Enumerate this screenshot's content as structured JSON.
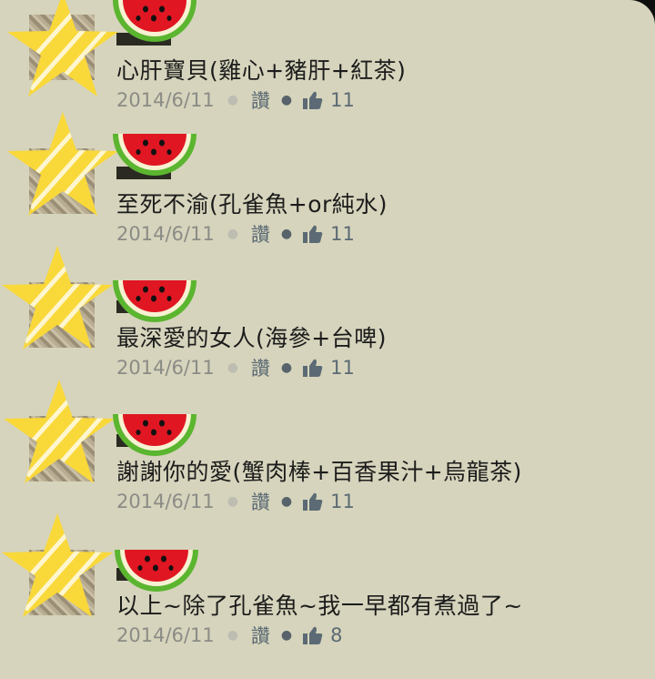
{
  "colors": {
    "background": "#d6d4bc",
    "meta_gray": "#8b8c86",
    "like_blue_gray": "#5b6a74",
    "star_yellow": "#f9d83a",
    "melon_red": "#e01622",
    "melon_green": "#5bb52f"
  },
  "comments": [
    {
      "text": "心肝寶貝(雞心+豬肝+紅茶)",
      "date": "2014/6/11",
      "like_label": "讚",
      "like_count": "11"
    },
    {
      "text": "至死不渝(孔雀魚+or純水)",
      "date": "2014/6/11",
      "like_label": "讚",
      "like_count": "11"
    },
    {
      "text": "最深愛的女人(海參+台啤)",
      "date": "2014/6/11",
      "like_label": "讚",
      "like_count": "11"
    },
    {
      "text": "謝謝你的愛(蟹肉棒+百香果汁+烏龍茶)",
      "date": "2014/6/11",
      "like_label": "讚",
      "like_count": "11"
    },
    {
      "text": "以上~除了孔雀魚~我一早都有煮過了~",
      "date": "2014/6/11",
      "like_label": "讚",
      "like_count": "8"
    }
  ],
  "icons": {
    "avatar_overlay": "star-sticker-icon",
    "name_overlay": "watermelon-sticker-icon",
    "like": "thumbs-up-icon",
    "separator": "dot-separator-icon"
  }
}
